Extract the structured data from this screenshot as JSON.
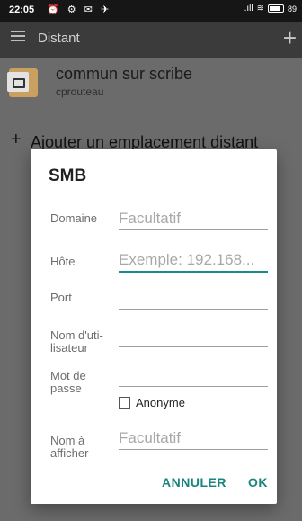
{
  "status_bar": {
    "time": "22:05",
    "left_icons": "⏰ ⚙ ✉ ✈",
    "signal": ".ıll",
    "wifi": "≋",
    "battery": "89"
  },
  "app_bar": {
    "menu_icon": "hamburger-menu-icon",
    "title": "Distant",
    "add_icon": "+"
  },
  "list": {
    "items": [
      {
        "title": "commun sur scribe",
        "subtitle": "cprouteau"
      }
    ],
    "add_label": "Ajouter un emplacement distant",
    "add_icon": "+"
  },
  "dialog": {
    "title": "SMB",
    "fields": {
      "domain": {
        "label": "Domaine",
        "value": "",
        "placeholder": "Facultatif"
      },
      "host": {
        "label": "Hôte",
        "value": "",
        "placeholder": "Exemple: 192.168..."
      },
      "port": {
        "label": "Port",
        "value": "",
        "placeholder": ""
      },
      "username": {
        "label": "Nom d'uti-lisateur",
        "value": "",
        "placeholder": ""
      },
      "password": {
        "label": "Mot de passe",
        "value": "",
        "placeholder": ""
      },
      "display_name": {
        "label": "Nom à afficher",
        "value": "",
        "placeholder": "Facultatif"
      }
    },
    "anonymous": {
      "label": "Anonyme",
      "checked": false
    },
    "buttons": {
      "cancel": "ANNULER",
      "ok": "OK"
    }
  },
  "colors": {
    "accent": "#19857f",
    "dim_overlay": "#6b6b6b",
    "app_bar": "#3b3b3b"
  }
}
